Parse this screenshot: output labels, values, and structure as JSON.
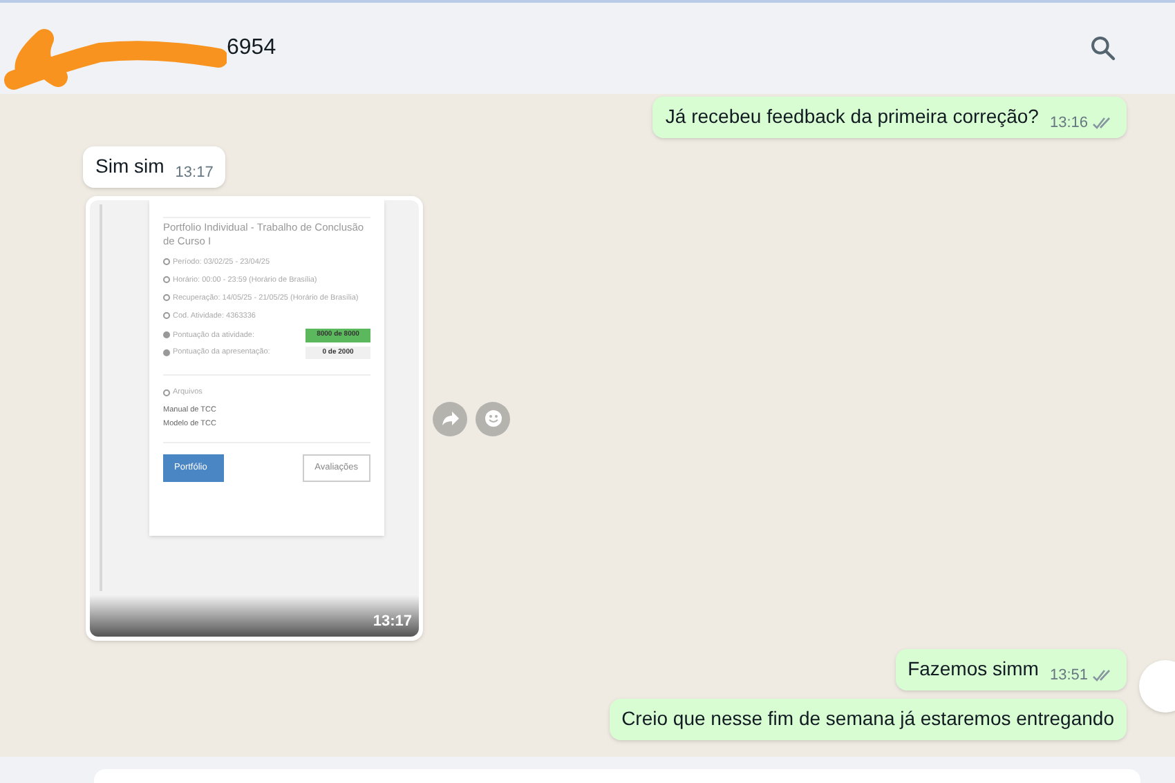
{
  "header": {
    "contact_name": "6954",
    "redacted": true
  },
  "messages": [
    {
      "kind": "text",
      "outgoing": true,
      "text": "Já recebeu feedback da primeira correção?",
      "time": "13:16",
      "read": false
    },
    {
      "kind": "text",
      "outgoing": false,
      "text": "Sim sim",
      "time": "13:17"
    },
    {
      "kind": "image",
      "outgoing": false,
      "time": "13:17",
      "document": {
        "title": "Portfolio Individual - Trabalho de Conclusão de Curso I",
        "details": [
          "Período: 03/02/25 - 23/04/25",
          "Horário: 00:00 - 23:59 (Horário de Brasília)",
          "Recuperação: 14/05/25 - 21/05/25 (Horário de Brasília)",
          "Cod. Atividade: 4363336"
        ],
        "scores": [
          {
            "label": "Pontuação da atividade:",
            "value": "8000 de 8000",
            "passed": true
          },
          {
            "label": "Pontuação da apresentação:",
            "value": "0 de 2000",
            "passed": false
          }
        ],
        "files_heading": "Arquivos",
        "files": [
          "Manual de TCC",
          "Modelo de TCC"
        ],
        "buttons": [
          {
            "label": "Portfólio",
            "primary": true
          },
          {
            "label": "Avaliações",
            "primary": false
          }
        ]
      }
    },
    {
      "kind": "text",
      "outgoing": true,
      "text": "Fazemos simm",
      "time": "13:51",
      "read": false
    },
    {
      "kind": "text",
      "outgoing": true,
      "text": "Creio que nesse fim de semana já estaremos entregando"
    }
  ]
}
